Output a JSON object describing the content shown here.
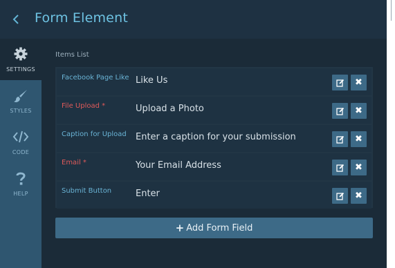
{
  "header": {
    "title": "Form Element",
    "back_icon": "chevron-left-icon"
  },
  "sidebar": {
    "items": [
      {
        "label": "SETTINGS",
        "icon": "gear-icon",
        "active": true
      },
      {
        "label": "STYLES",
        "icon": "paintbrush-icon",
        "active": false
      },
      {
        "label": "CODE",
        "icon": "code-icon",
        "active": false
      },
      {
        "label": "HELP",
        "icon": "question-icon",
        "active": false
      }
    ]
  },
  "main": {
    "items_label": "Items List",
    "items": [
      {
        "label": "Facebook Page Like",
        "value": "Like Us",
        "required": false
      },
      {
        "label": "File Upload *",
        "value": "Upload a Photo",
        "required": true
      },
      {
        "label": "Caption for Upload",
        "value": "Enter a caption for your submission",
        "required": false
      },
      {
        "label": "Email *",
        "value": "Your Email Address",
        "required": true
      },
      {
        "label": "Submit Button",
        "value": "Enter",
        "required": false
      }
    ],
    "add_button": {
      "icon": "+",
      "label": "Add Form Field"
    }
  },
  "colors": {
    "accent": "#6ec3e3",
    "required": "#e05a5a",
    "button": "#3d6a87",
    "sidebar": "#2f5670",
    "background": "#1b2b38"
  }
}
